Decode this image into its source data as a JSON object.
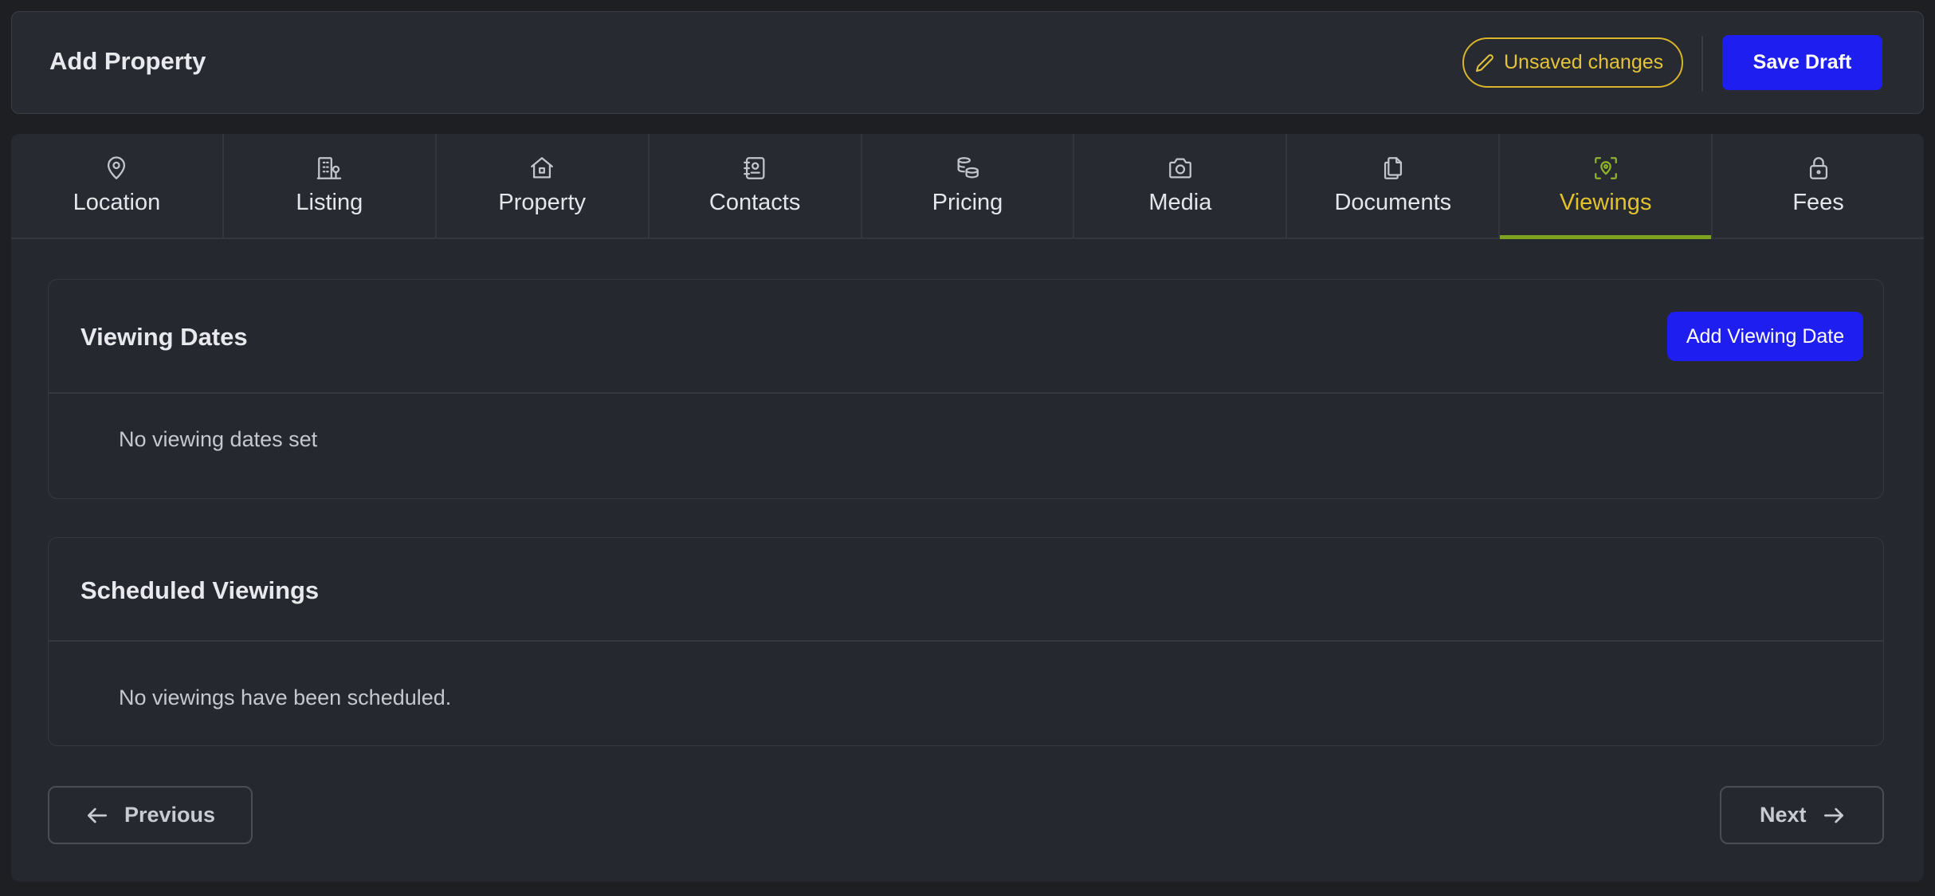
{
  "header": {
    "title": "Add Property",
    "unsaved_label": "Unsaved changes",
    "save_label": "Save Draft"
  },
  "tabs": [
    {
      "label": "Location",
      "icon": "map-pin-icon"
    },
    {
      "label": "Listing",
      "icon": "building-icon"
    },
    {
      "label": "Property",
      "icon": "house-icon"
    },
    {
      "label": "Contacts",
      "icon": "contact-book-icon"
    },
    {
      "label": "Pricing",
      "icon": "coins-icon"
    },
    {
      "label": "Media",
      "icon": "camera-icon"
    },
    {
      "label": "Documents",
      "icon": "documents-icon"
    },
    {
      "label": "Viewings",
      "icon": "scan-location-icon",
      "active": true
    },
    {
      "label": "Fees",
      "icon": "lock-icon"
    }
  ],
  "viewing_dates": {
    "title": "Viewing Dates",
    "add_label": "Add Viewing Date",
    "empty": "No viewing dates set"
  },
  "scheduled_viewings": {
    "title": "Scheduled Viewings",
    "empty": "No viewings have been scheduled."
  },
  "footer": {
    "previous_label": "Previous",
    "next_label": "Next"
  },
  "colors": {
    "accent_blue": "#1f1ef0",
    "active_tab_text": "#e2c12c",
    "active_tab_underline": "#7ea21d",
    "unsaved_yellow": "#e4c23a"
  }
}
